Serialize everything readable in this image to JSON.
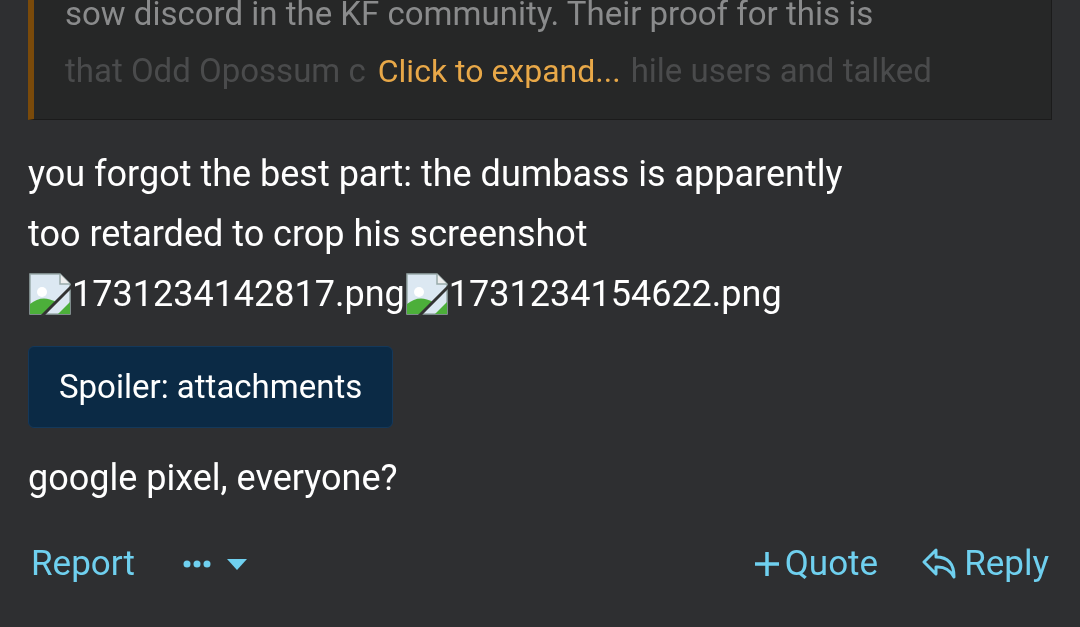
{
  "quote": {
    "lines": [
      "sow discord in the KF community. Their proof for this is"
    ],
    "faded_parts": [
      "that Odd Opossum c",
      "hile users and talked"
    ],
    "expand_link": "Click to expand..."
  },
  "message": {
    "lines": [
      "you forgot the best part: the dumbass is apparently",
      "too retarded to crop his screenshot"
    ],
    "attachments": [
      {
        "filename": "1731234142817.png"
      },
      {
        "filename": "1731234154622.png"
      }
    ]
  },
  "spoiler": {
    "label": "Spoiler: attachments"
  },
  "closing": "google pixel, everyone?",
  "actions": {
    "left": [
      {
        "kind": "text",
        "label": "Report"
      },
      {
        "kind": "more"
      }
    ],
    "right": [
      {
        "kind": "quote",
        "label": "Quote"
      },
      {
        "kind": "reply",
        "label": "Reply"
      }
    ]
  }
}
